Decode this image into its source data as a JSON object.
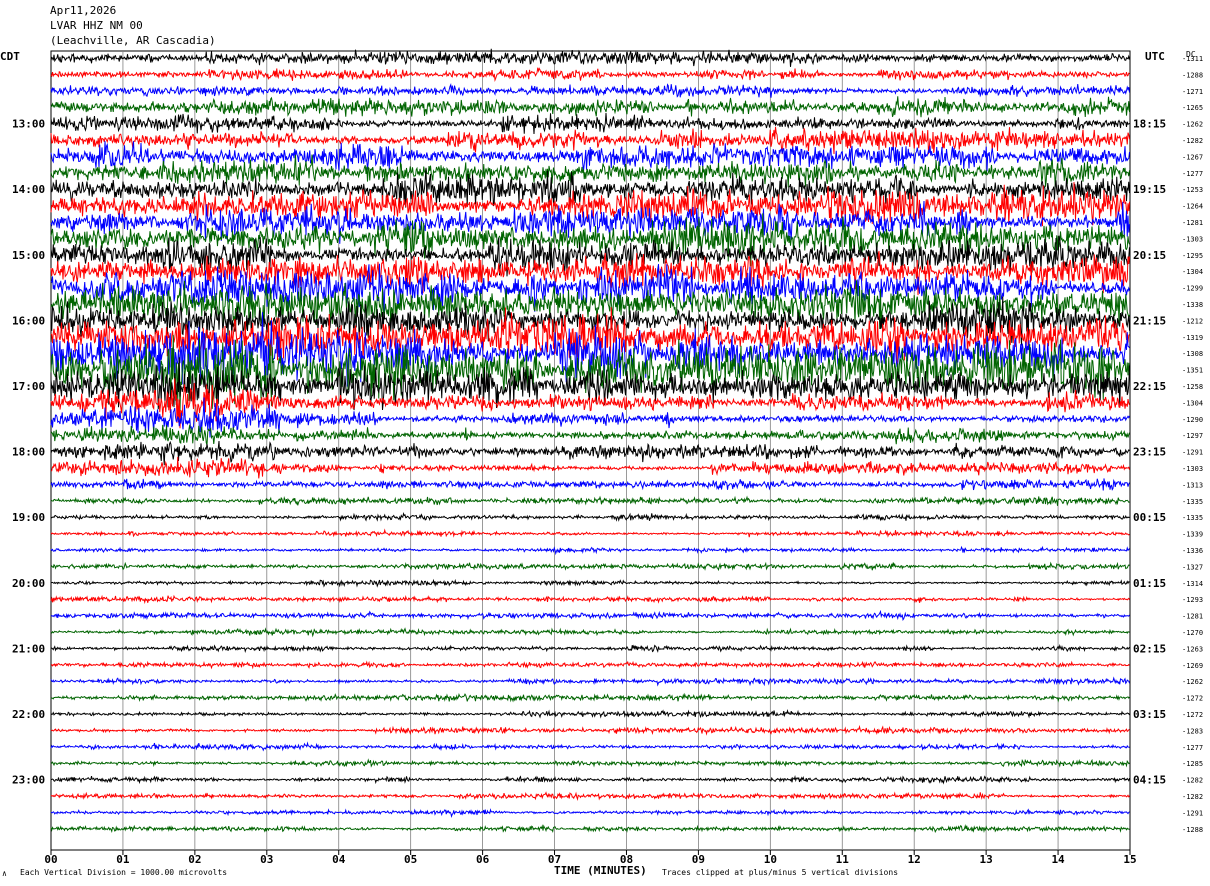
{
  "header": {
    "date": "Apr11,2026",
    "station": "LVAR HHZ NM 00",
    "location": "(Leachville, AR Cascadia)"
  },
  "left_timezone": "CDT",
  "right_timezone": "UTC",
  "dc_label": "DC",
  "footer": {
    "scale_note": "Each Vertical Division = 1000.00 microvolts",
    "clip_note": "Traces clipped at plus/minus 5 vertical divisions",
    "corner_mark": "∧"
  },
  "colors": {
    "cycle": [
      "#000000",
      "#ff0000",
      "#0000ff",
      "#006400"
    ],
    "grid": "#808080"
  },
  "chart_data": {
    "type": "helicorder",
    "xlabel": "TIME (MINUTES)",
    "x_ticks": [
      "00",
      "01",
      "02",
      "03",
      "04",
      "05",
      "06",
      "07",
      "08",
      "09",
      "10",
      "11",
      "12",
      "13",
      "14",
      "15"
    ],
    "xlim": [
      0,
      15
    ],
    "left_hour_labels": [
      {
        "row": 4,
        "label": "13:00"
      },
      {
        "row": 8,
        "label": "14:00"
      },
      {
        "row": 12,
        "label": "15:00"
      },
      {
        "row": 16,
        "label": "16:00"
      },
      {
        "row": 20,
        "label": "17:00"
      },
      {
        "row": 24,
        "label": "18:00"
      },
      {
        "row": 28,
        "label": "19:00"
      },
      {
        "row": 32,
        "label": "20:00"
      },
      {
        "row": 36,
        "label": "21:00"
      },
      {
        "row": 40,
        "label": "22:00"
      },
      {
        "row": 44,
        "label": "23:00"
      }
    ],
    "right_hour_labels": [
      {
        "row": 4,
        "label": "18:15"
      },
      {
        "row": 8,
        "label": "19:15"
      },
      {
        "row": 12,
        "label": "20:15"
      },
      {
        "row": 16,
        "label": "21:15"
      },
      {
        "row": 20,
        "label": "22:15"
      },
      {
        "row": 24,
        "label": "23:15"
      },
      {
        "row": 28,
        "label": "00:15"
      },
      {
        "row": 32,
        "label": "01:15"
      },
      {
        "row": 36,
        "label": "02:15"
      },
      {
        "row": 40,
        "label": "03:15"
      },
      {
        "row": 44,
        "label": "04:15"
      }
    ],
    "dc_offsets": [
      "-1311",
      "-1288",
      "-1271",
      "-1265",
      "-1262",
      "-1282",
      "-1267",
      "-1277",
      "-1253",
      "-1264",
      "-1281",
      "-1303",
      "-1295",
      "-1304",
      "-1299",
      "-1338",
      "-1212",
      "-1319",
      "-1308",
      "-1351",
      "-1258",
      "-1304",
      "-1290",
      "-1297",
      "-1291",
      "-1303",
      "-1313",
      "-1335",
      "-1335",
      "-1339",
      "-1336",
      "-1327",
      "-1314",
      "-1293",
      "-1281",
      "-1270",
      "-1263",
      "-1269",
      "-1262",
      "-1272",
      "-1272",
      "-1283",
      "-1277",
      "-1285",
      "-1282",
      "-1282",
      "-1291",
      "-1288"
    ],
    "trace_activity": [
      2.5,
      1.8,
      2.0,
      3.2,
      3.5,
      4.0,
      4.5,
      5.0,
      6.0,
      6.0,
      6.5,
      7.0,
      6.5,
      6.5,
      7.5,
      8.0,
      8.0,
      8.5,
      9.0,
      9.0,
      7.0,
      3.0,
      2.5,
      2.5,
      2.5,
      2.0,
      2.0,
      1.5,
      1.2,
      1.0,
      1.0,
      1.0,
      1.0,
      1.0,
      1.0,
      1.0,
      1.0,
      1.0,
      1.0,
      1.0,
      1.0,
      1.0,
      1.0,
      1.0,
      1.0,
      1.0,
      1.0,
      1.0
    ],
    "event": {
      "rows": [
        16,
        17,
        18,
        19,
        20,
        21,
        22,
        23,
        24,
        25
      ],
      "start_min": 0.0,
      "end_min": 3.2,
      "peak_min": 1.9
    },
    "clip_divisions": 5
  }
}
